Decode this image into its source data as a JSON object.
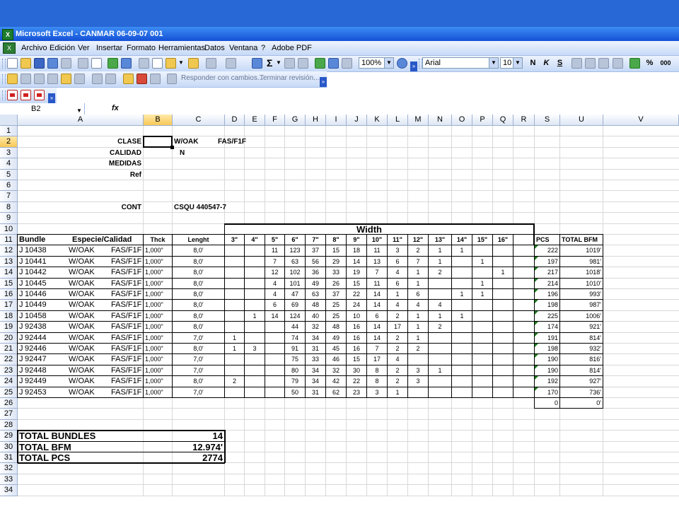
{
  "window": {
    "title": "Microsoft Excel - CANMAR 06-09-07 001"
  },
  "menu": {
    "items": [
      "Archivo",
      "Edición",
      "Ver",
      "Insertar",
      "Formato",
      "Herramientas",
      "Datos",
      "Ventana",
      "?",
      "Adobe PDF"
    ]
  },
  "toolbar": {
    "zoom": "100%",
    "font_name": "Arial",
    "font_size": "10",
    "bold": "N",
    "italic": "K",
    "underline": "S",
    "percent": "%",
    "thousands": "000",
    "sigma": "Σ",
    "review_reply": "Responder con cambios...",
    "review_end": "Terminar revisión..."
  },
  "formula_bar": {
    "name_box": "B2",
    "fx": "fx",
    "formula": ""
  },
  "columns": [
    "A",
    "B",
    "C",
    "D",
    "E",
    "F",
    "G",
    "H",
    "I",
    "J",
    "K",
    "L",
    "M",
    "N",
    "O",
    "P",
    "Q",
    "R",
    "S",
    "U",
    "V"
  ],
  "rows": [
    "1",
    "2",
    "3",
    "4",
    "5",
    "6",
    "7",
    "8",
    "9",
    "10",
    "11",
    "12",
    "13",
    "14",
    "15",
    "16",
    "17",
    "18",
    "19",
    "20",
    "21",
    "22",
    "23",
    "24",
    "25",
    "26",
    "27",
    "28",
    "29",
    "30",
    "31",
    "32",
    "33",
    "34"
  ],
  "sheet": {
    "header_labels": {
      "clase": "CLASE",
      "calidad": "CALIDAD",
      "medidas": "MEDIDAS",
      "ref": "Ref",
      "cont": "CONT"
    },
    "header_values": {
      "clase_1": "W/OAK",
      "clase_2": "FAS/F1F",
      "calidad": "N",
      "cont": "CSQU 440547-7"
    },
    "width_title": "Width",
    "table_headers": {
      "bundle": "Bundle",
      "especie": "Especie/Calidad",
      "thck": "Thck",
      "length": "Lenght",
      "pcs": "PCS",
      "total_bfm": "TOTAL BFM"
    },
    "width_headers": [
      "3\"",
      "4\"",
      "5\"",
      "6\"",
      "7\"",
      "8\"",
      "9\"",
      "10\"",
      "11\"",
      "12\"",
      "13\"",
      "14\"",
      "15\"",
      "16\""
    ],
    "bundles": [
      {
        "prefix": "J",
        "num": "10438",
        "species": "W/OAK",
        "grade": "FAS/F1F",
        "thck": "1,000\"",
        "length": "8,0'",
        "w": [
          "",
          "",
          "11",
          "123",
          "37",
          "15",
          "18",
          "11",
          "3",
          "2",
          "1",
          "1",
          "",
          ""
        ],
        "pcs": "222",
        "bfm": "1019'"
      },
      {
        "prefix": "J",
        "num": "10441",
        "species": "W/OAK",
        "grade": "FAS/F1F",
        "thck": "1,000\"",
        "length": "8,0'",
        "w": [
          "",
          "",
          "7",
          "63",
          "56",
          "29",
          "14",
          "13",
          "6",
          "7",
          "1",
          "",
          "1",
          ""
        ],
        "pcs": "197",
        "bfm": "981'"
      },
      {
        "prefix": "J",
        "num": "10442",
        "species": "W/OAK",
        "grade": "FAS/F1F",
        "thck": "1,000\"",
        "length": "8,0'",
        "w": [
          "",
          "",
          "12",
          "102",
          "36",
          "33",
          "19",
          "7",
          "4",
          "1",
          "2",
          "",
          "",
          "1"
        ],
        "pcs": "217",
        "bfm": "1018'"
      },
      {
        "prefix": "J",
        "num": "10445",
        "species": "W/OAK",
        "grade": "FAS/F1F",
        "thck": "1,000\"",
        "length": "8,0'",
        "w": [
          "",
          "",
          "4",
          "101",
          "49",
          "26",
          "15",
          "11",
          "6",
          "1",
          "",
          "",
          "1",
          ""
        ],
        "pcs": "214",
        "bfm": "1010'"
      },
      {
        "prefix": "J",
        "num": "10446",
        "species": "W/OAK",
        "grade": "FAS/F1F",
        "thck": "1,000\"",
        "length": "8,0'",
        "w": [
          "",
          "",
          "4",
          "47",
          "63",
          "37",
          "22",
          "14",
          "1",
          "6",
          "",
          "1",
          "1",
          ""
        ],
        "pcs": "196",
        "bfm": "993'"
      },
      {
        "prefix": "J",
        "num": "10449",
        "species": "W/OAK",
        "grade": "FAS/F1F",
        "thck": "1,000\"",
        "length": "8,0'",
        "w": [
          "",
          "",
          "6",
          "69",
          "48",
          "25",
          "24",
          "14",
          "4",
          "4",
          "4",
          "",
          "",
          ""
        ],
        "pcs": "198",
        "bfm": "987'"
      },
      {
        "prefix": "J",
        "num": "10458",
        "species": "W/OAK",
        "grade": "FAS/F1F",
        "thck": "1,000\"",
        "length": "8,0'",
        "w": [
          "",
          "1",
          "14",
          "124",
          "40",
          "25",
          "10",
          "6",
          "2",
          "1",
          "1",
          "1",
          "",
          ""
        ],
        "pcs": "225",
        "bfm": "1006'"
      },
      {
        "prefix": "J",
        "num": "92438",
        "species": "W/OAK",
        "grade": "FAS/F1F",
        "thck": "1,000\"",
        "length": "8,0'",
        "w": [
          "",
          "",
          "",
          "44",
          "32",
          "48",
          "16",
          "14",
          "17",
          "1",
          "2",
          "",
          "",
          ""
        ],
        "pcs": "174",
        "bfm": "921'"
      },
      {
        "prefix": "J",
        "num": "92444",
        "species": "W/OAK",
        "grade": "FAS/F1F",
        "thck": "1,000\"",
        "length": "7,0'",
        "w": [
          "1",
          "",
          "",
          "74",
          "34",
          "49",
          "16",
          "14",
          "2",
          "1",
          "",
          "",
          "",
          ""
        ],
        "pcs": "191",
        "bfm": "814'"
      },
      {
        "prefix": "J",
        "num": "92446",
        "species": "W/OAK",
        "grade": "FAS/F1F",
        "thck": "1,000\"",
        "length": "8,0'",
        "w": [
          "1",
          "3",
          "",
          "91",
          "31",
          "45",
          "16",
          "7",
          "2",
          "2",
          "",
          "",
          "",
          ""
        ],
        "pcs": "198",
        "bfm": "932'"
      },
      {
        "prefix": "J",
        "num": "92447",
        "species": "W/OAK",
        "grade": "FAS/F1F",
        "thck": "1,000\"",
        "length": "7,0'",
        "w": [
          "",
          "",
          "",
          "75",
          "33",
          "46",
          "15",
          "17",
          "4",
          "",
          "",
          "",
          "",
          ""
        ],
        "pcs": "190",
        "bfm": "816'"
      },
      {
        "prefix": "J",
        "num": "92448",
        "species": "W/OAK",
        "grade": "FAS/F1F",
        "thck": "1,000\"",
        "length": "7,0'",
        "w": [
          "",
          "",
          "",
          "80",
          "34",
          "32",
          "30",
          "8",
          "2",
          "3",
          "1",
          "",
          "",
          ""
        ],
        "pcs": "190",
        "bfm": "814'"
      },
      {
        "prefix": "J",
        "num": "92449",
        "species": "W/OAK",
        "grade": "FAS/F1F",
        "thck": "1,000\"",
        "length": "8,0'",
        "w": [
          "2",
          "",
          "",
          "79",
          "34",
          "42",
          "22",
          "8",
          "2",
          "3",
          "",
          "",
          "",
          ""
        ],
        "pcs": "192",
        "bfm": "927'"
      },
      {
        "prefix": "J",
        "num": "92453",
        "species": "W/OAK",
        "grade": "FAS/F1F",
        "thck": "1,000\"",
        "length": "7,0'",
        "w": [
          "",
          "",
          "",
          "50",
          "31",
          "62",
          "23",
          "3",
          "1",
          "",
          "",
          "",
          "",
          ""
        ],
        "pcs": "170",
        "bfm": "736'"
      }
    ],
    "row26": {
      "pcs": "0",
      "bfm": "0'"
    },
    "totals": [
      {
        "label": "TOTAL BUNDLES",
        "value": "14"
      },
      {
        "label": "TOTAL BFM",
        "value": "12.974'"
      },
      {
        "label": "TOTAL PCS",
        "value": "2774"
      }
    ]
  }
}
